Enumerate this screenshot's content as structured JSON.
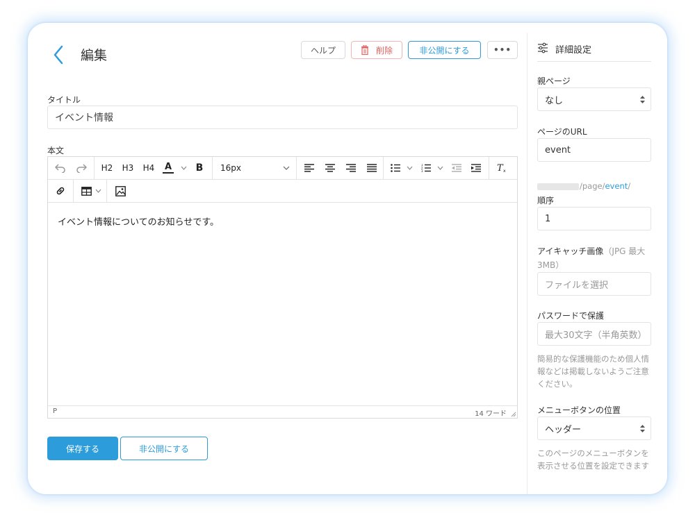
{
  "header": {
    "title": "編集",
    "help_label": "ヘルプ",
    "delete_label": "削除",
    "unpublish_label": "非公開にする",
    "more_label": "•••"
  },
  "form": {
    "title_label": "タイトル",
    "title_value": "イベント情報",
    "body_label": "本文"
  },
  "editor": {
    "toolbar": {
      "h2": "H2",
      "h3": "H3",
      "h4": "H4",
      "font_color": "A",
      "bold": "B",
      "font_size": "16px",
      "clear_format": "Tx"
    },
    "content": "イベント情報についてのお知らせです。",
    "status_path": "P",
    "word_count": "14 ワード"
  },
  "footer": {
    "save_label": "保存する",
    "unpublish_label": "非公開にする"
  },
  "sidebar": {
    "title": "詳細設定",
    "parent_label": "親ページ",
    "parent_value": "なし",
    "url_label": "ページのURL",
    "url_value": "event",
    "url_path": "/page/",
    "url_slug": "event",
    "url_suffix": "/",
    "order_label": "順序",
    "order_value": "1",
    "eyecatch_label": "アイキャッチ画像",
    "eyecatch_note": "（JPG 最大3MB）",
    "eyecatch_placeholder": "ファイルを選択",
    "password_label": "パスワードで保護",
    "password_placeholder": "最大30文字（半角英数）",
    "password_hint": "簡易的な保護機能のため個人情報などは掲載しないようご注意ください。",
    "menu_label": "メニューボタンの位置",
    "menu_value": "ヘッダー",
    "menu_hint": "このページのメニューボタンを表示させる位置を設定できます"
  },
  "colors": {
    "accent": "#2d9cdb",
    "danger": "#e06060"
  }
}
